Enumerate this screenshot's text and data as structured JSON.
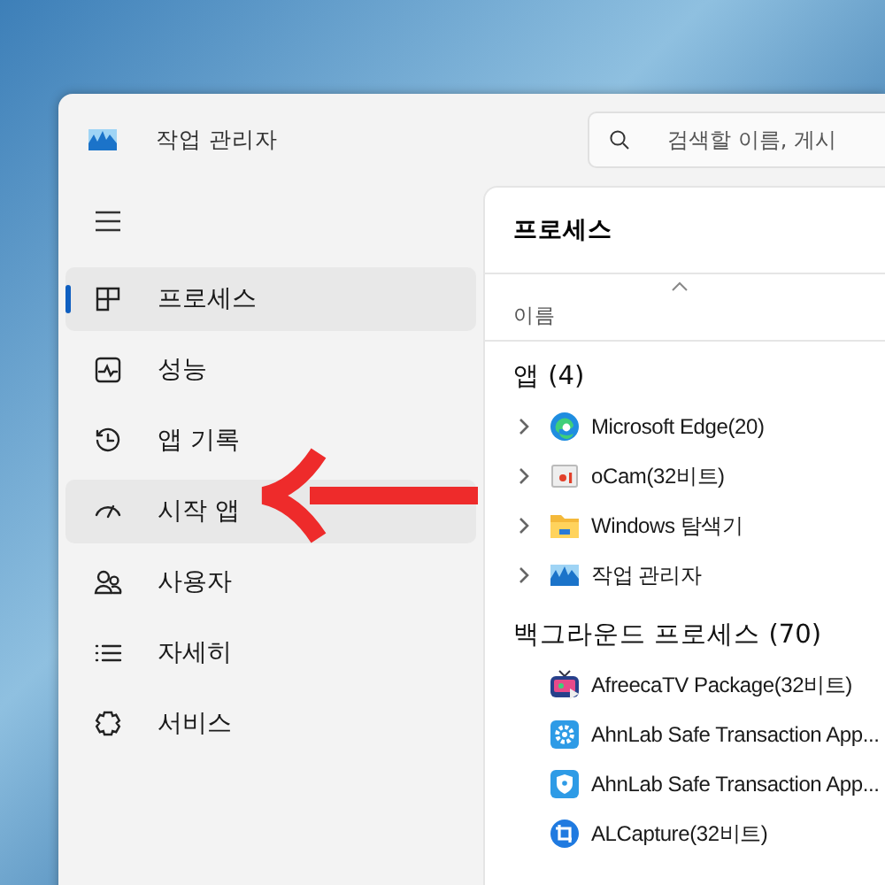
{
  "window": {
    "title": "작업 관리자"
  },
  "search": {
    "placeholder": "검색할 이름, 게시"
  },
  "nav": [
    {
      "label": "프로세스",
      "kind": "processes",
      "selected": true,
      "hovered": false
    },
    {
      "label": "성능",
      "kind": "performance",
      "selected": false,
      "hovered": false
    },
    {
      "label": "앱 기록",
      "kind": "history",
      "selected": false,
      "hovered": false
    },
    {
      "label": "시작 앱",
      "kind": "startup",
      "selected": false,
      "hovered": true
    },
    {
      "label": "사용자",
      "kind": "users",
      "selected": false,
      "hovered": false
    },
    {
      "label": "자세히",
      "kind": "details",
      "selected": false,
      "hovered": false
    },
    {
      "label": "서비스",
      "kind": "services",
      "selected": false,
      "hovered": false
    }
  ],
  "page": {
    "title": "프로세스",
    "column": "이름"
  },
  "groups": [
    {
      "title": "앱 (4)",
      "rows": [
        {
          "name": "Microsoft Edge(20)",
          "kind": "edge",
          "expanded": false
        },
        {
          "name": "oCam(32비트)",
          "kind": "ocam",
          "expanded": false
        },
        {
          "name": "Windows 탐색기",
          "kind": "folder",
          "expanded": false
        },
        {
          "name": "작업 관리자",
          "kind": "taskmgr",
          "expanded": false
        }
      ]
    },
    {
      "title": "백그라운드 프로세스 (70)",
      "rows": [
        {
          "name": "AfreecaTV Package(32비트)",
          "kind": "tv"
        },
        {
          "name": "AhnLab Safe Transaction App...",
          "kind": "gear"
        },
        {
          "name": "AhnLab Safe Transaction App...",
          "kind": "shield"
        },
        {
          "name": "ALCapture(32비트)",
          "kind": "crop"
        }
      ]
    }
  ]
}
